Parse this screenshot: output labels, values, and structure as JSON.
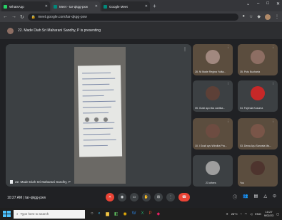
{
  "browser": {
    "tabs": [
      {
        "label": "WhatsApp",
        "color": "#25d366"
      },
      {
        "label": "Meet - tar-qkgg-pxw",
        "color": "#00897b",
        "active": true
      },
      {
        "label": "Google Meet",
        "color": "#00897b"
      }
    ],
    "url": "meet.google.com/tar-qkgg-pxw",
    "newtab": "+",
    "window_controls": [
      "⌄",
      "–",
      "□",
      "✕"
    ]
  },
  "presentation": {
    "banner": "22. Made Diah Sri Maharani Sandhy, P is presenting"
  },
  "main_tile": {
    "caption": "22. Made Diah Sri Maharani Sandhy, P"
  },
  "participants": [
    {
      "name": "28. Ni Made Regina Yulita...",
      "face": "#a1887f",
      "video": true
    },
    {
      "name": "35. Putu Bucharta",
      "face": "#8d6e63",
      "video": true
    },
    {
      "name": "05. Gusti ayu eka cantika...",
      "face": "#5d4037",
      "video": false
    },
    {
      "name": "04. Fajrinda Kusuma",
      "face": "#c62828",
      "video": false
    },
    {
      "name": "10. I Gusti ayu Windha Pra...",
      "face": "#6d4c41",
      "video": true
    },
    {
      "name": "03. Dewa Ayu Sanvata Ma...",
      "face": "#795548",
      "video": true
    },
    {
      "name": "23 others",
      "face": "#9e9e9e",
      "video": false
    },
    {
      "name": "You",
      "face": "#4e342e",
      "video": true
    }
  ],
  "controls": {
    "time": "10:27 AM",
    "separator": "|",
    "meeting_code": "tar-qkgg-pxw"
  },
  "taskbar": {
    "search_placeholder": "Type here to search",
    "weather": "26°C",
    "time": "10:27",
    "date": "9/02/23",
    "lang": "ENG"
  },
  "colors": {
    "hangup": "#ea4335",
    "background": "#202124",
    "tile": "#3c4043"
  }
}
